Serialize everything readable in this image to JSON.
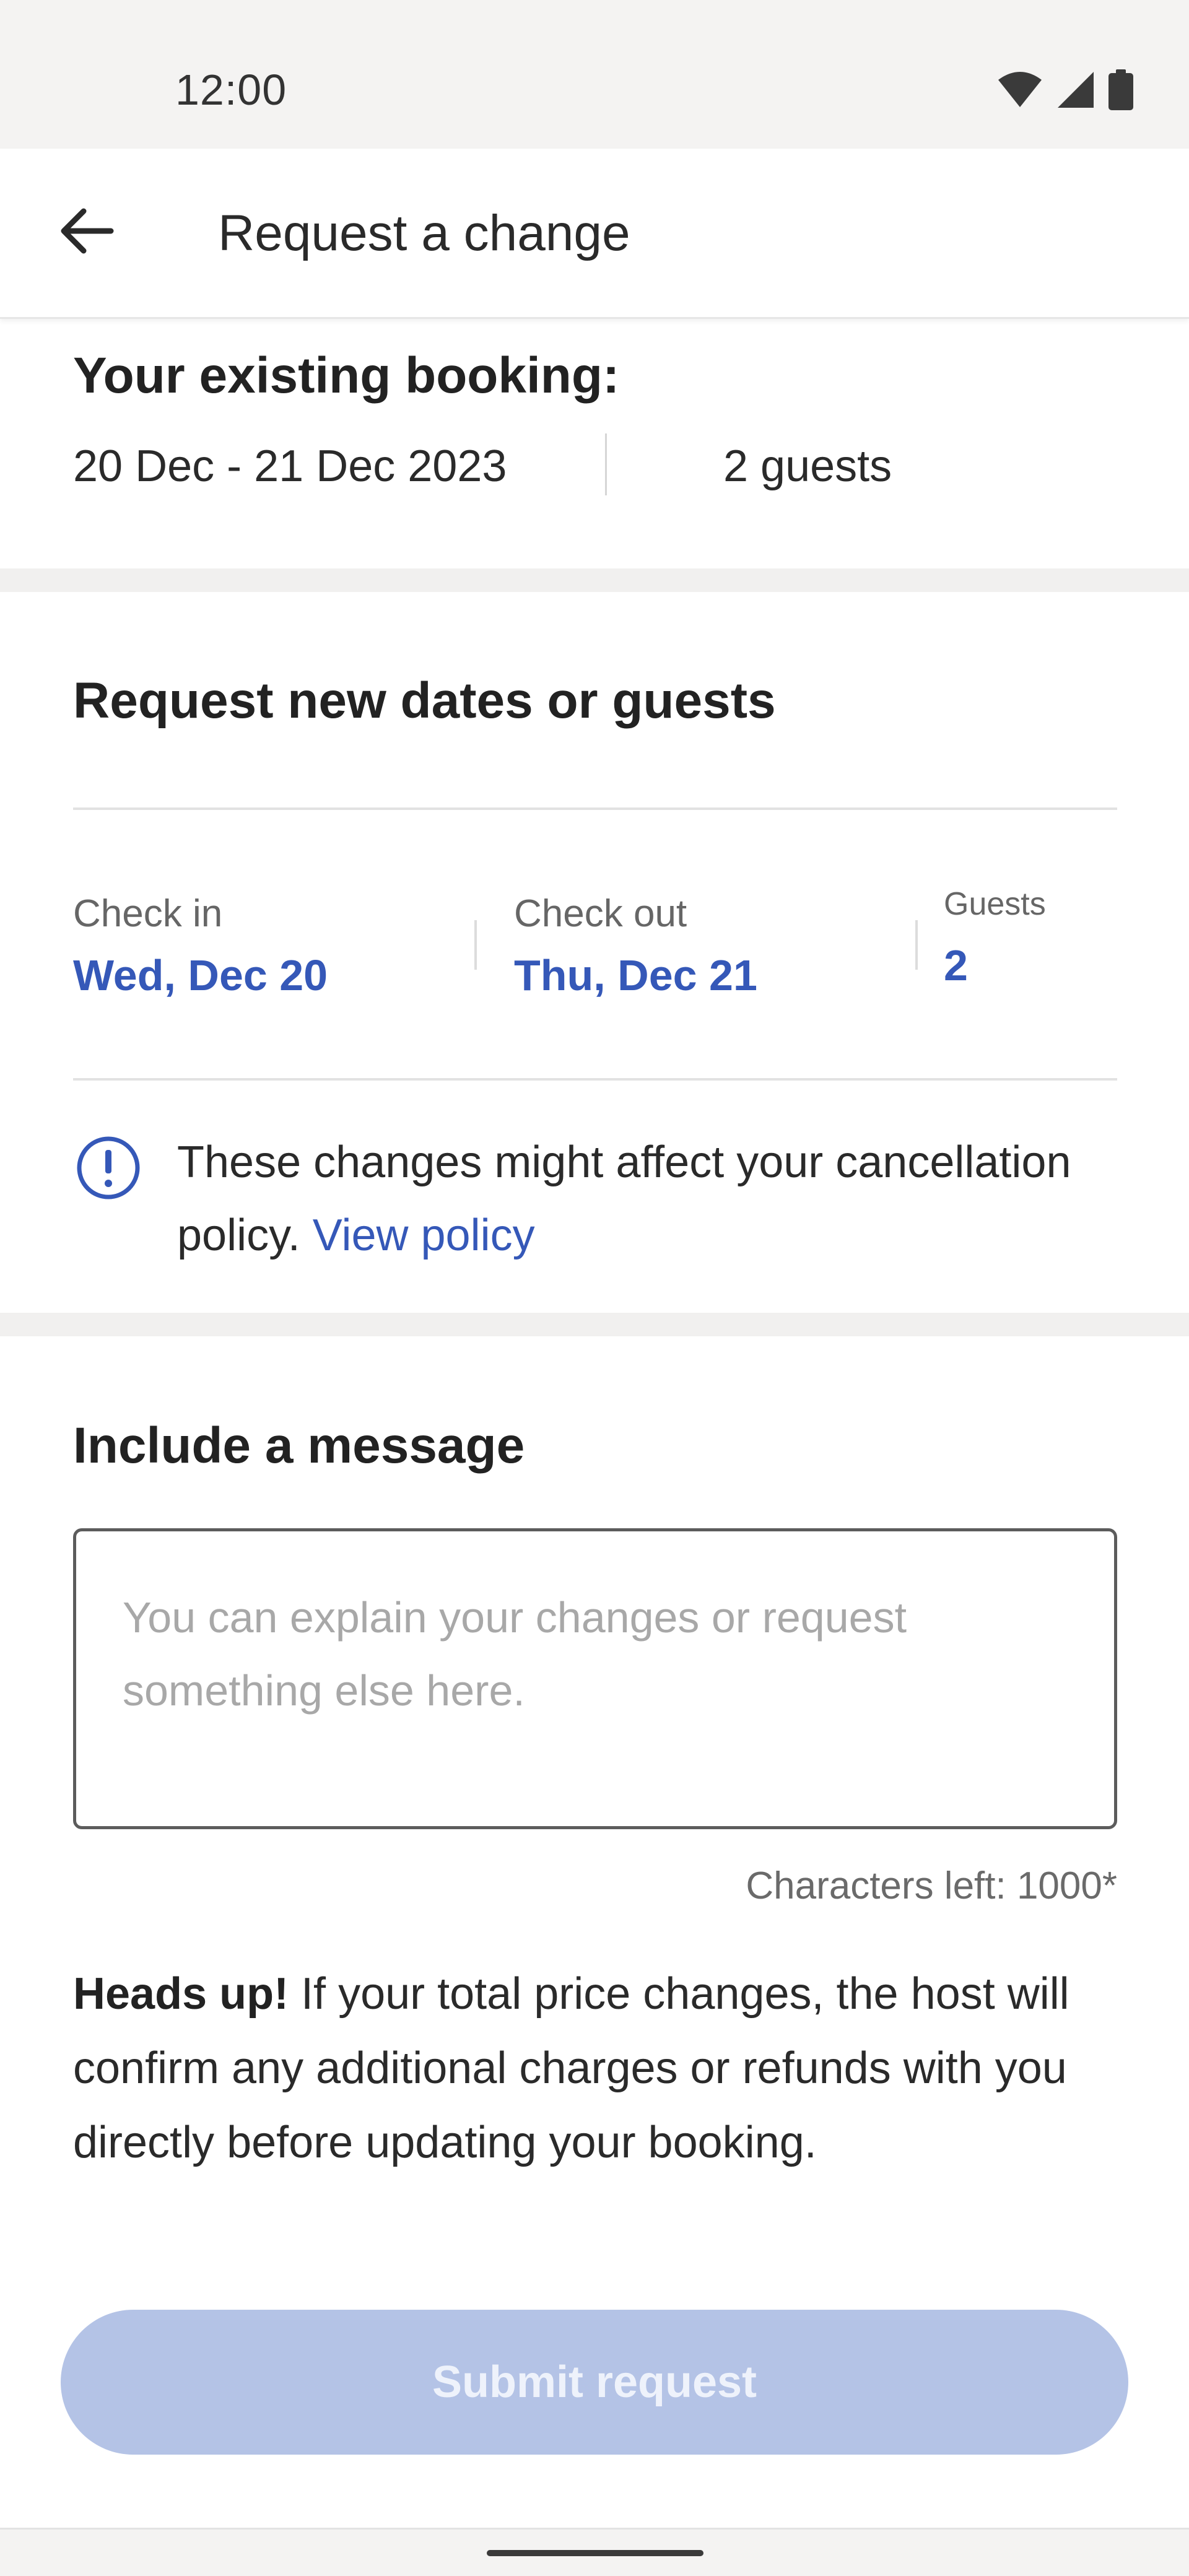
{
  "status_bar": {
    "time": "12:00",
    "icons": [
      "wifi-icon",
      "signal-icon",
      "battery-icon"
    ]
  },
  "app_bar": {
    "back_icon": "arrow-left-icon",
    "title": "Request a change"
  },
  "existing_booking": {
    "heading": "Your existing booking:",
    "dates": "20 Dec - 21 Dec 2023",
    "guests": "2 guests"
  },
  "request_section": {
    "heading": "Request new dates or guests",
    "check_in": {
      "label": "Check in",
      "value": "Wed, Dec 20"
    },
    "check_out": {
      "label": "Check out",
      "value": "Thu, Dec 21"
    },
    "guests": {
      "label": "Guests",
      "value": "2"
    },
    "notice": {
      "icon": "info-circle-icon",
      "text": "These changes might affect your cancellation policy. ",
      "link": "View policy"
    }
  },
  "message_section": {
    "heading": "Include a message",
    "placeholder": "You can explain your changes or request something else here.",
    "value": "",
    "chars_left": "Characters left: 1000*"
  },
  "heads_up": {
    "bold": "Heads up!",
    "text": " If your total price changes, the host will confirm any additional charges or refunds with you directly before updating your booking."
  },
  "submit": {
    "label": "Submit request",
    "enabled": false
  },
  "colors": {
    "accent": "#3558b8",
    "submit_disabled_bg": "#b4c3e6",
    "section_gap": "#f1f0ef"
  }
}
